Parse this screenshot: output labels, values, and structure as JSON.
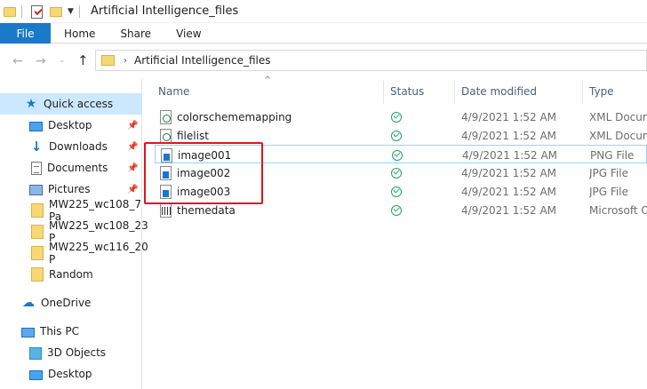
{
  "window": {
    "title": "Artificial Intelligence_files"
  },
  "ribbon": {
    "tabs": [
      "File",
      "Home",
      "Share",
      "View"
    ]
  },
  "address": {
    "path": "Artificial Intelligence_files"
  },
  "nav_pane": {
    "items": [
      {
        "label": "Quick access",
        "icon": "star-icon",
        "pinned": false,
        "selected": true
      },
      {
        "label": "Desktop",
        "icon": "desktop-icon",
        "pinned": true
      },
      {
        "label": "Downloads",
        "icon": "download-icon",
        "pinned": true
      },
      {
        "label": "Documents",
        "icon": "documents-icon",
        "pinned": true
      },
      {
        "label": "Pictures",
        "icon": "pictures-icon",
        "pinned": true
      },
      {
        "label": "MW225_wc108_7 Pa",
        "icon": "folder-icon"
      },
      {
        "label": "MW225_wc108_23 P",
        "icon": "folder-icon"
      },
      {
        "label": "MW225_wc116_20 P",
        "icon": "folder-icon"
      },
      {
        "label": "Random",
        "icon": "folder-icon"
      },
      {
        "label": "OneDrive",
        "icon": "cloud-icon"
      },
      {
        "label": "This PC",
        "icon": "computer-icon"
      },
      {
        "label": "3D Objects",
        "icon": "3d-objects-icon"
      },
      {
        "label": "Desktop",
        "icon": "desktop-icon"
      }
    ]
  },
  "file_list": {
    "columns": [
      "Name",
      "Status",
      "Date modified",
      "Type"
    ],
    "rows": [
      {
        "name": "colorschememapping",
        "date": "4/9/2021 1:52 AM",
        "type": "XML Document",
        "icon": "xml-file-icon"
      },
      {
        "name": "filelist",
        "date": "4/9/2021 1:52 AM",
        "type": "XML Document",
        "icon": "xml-file-icon"
      },
      {
        "name": "image001",
        "date": "4/9/2021 1:52 AM",
        "type": "PNG File",
        "icon": "image-file-icon"
      },
      {
        "name": "image002",
        "date": "4/9/2021 1:52 AM",
        "type": "JPG File",
        "icon": "image-file-icon"
      },
      {
        "name": "image003",
        "date": "4/9/2021 1:52 AM",
        "type": "JPG File",
        "icon": "image-file-icon"
      },
      {
        "name": "themedata",
        "date": "4/9/2021 1:52 AM",
        "type": "Microsoft Office",
        "icon": "theme-file-icon"
      }
    ]
  },
  "colors": {
    "accent": "#1979ca",
    "selection": "#cce8ff",
    "highlight_box": "#e0141e",
    "status_ok": "#21a366"
  }
}
